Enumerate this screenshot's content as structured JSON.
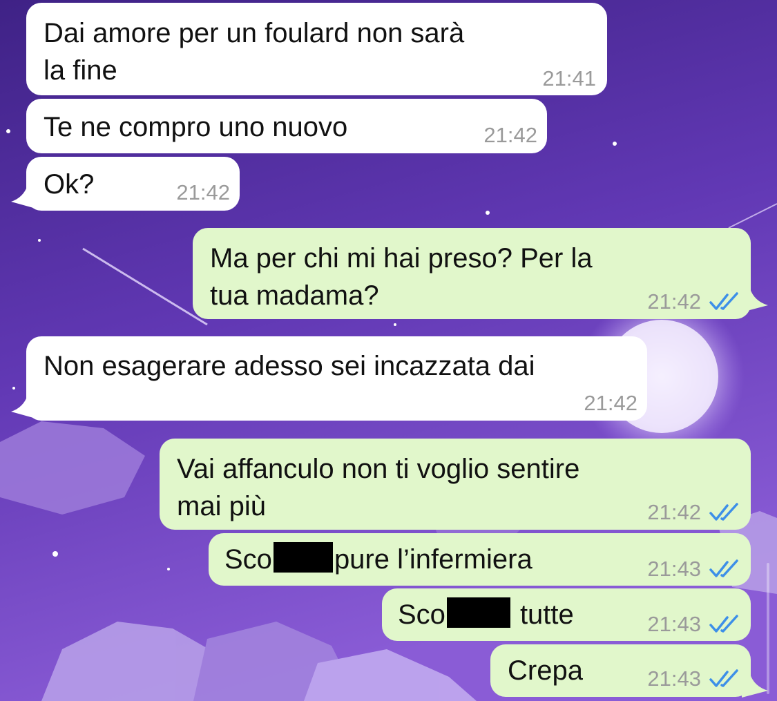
{
  "chat": {
    "messages": [
      {
        "direction": "incoming",
        "text_lines": [
          "Dai amore per un foulard non sarà",
          "la fine"
        ],
        "time": "21:41"
      },
      {
        "direction": "incoming",
        "text_lines": [
          "Te ne compro uno nuovo"
        ],
        "time": "21:42"
      },
      {
        "direction": "incoming",
        "text_lines": [
          "Ok?"
        ],
        "time": "21:42"
      },
      {
        "direction": "outgoing",
        "text_lines": [
          "Ma per chi mi hai preso? Per la",
          "tua madama?"
        ],
        "time": "21:42",
        "read": true
      },
      {
        "direction": "incoming",
        "text_lines": [
          "Non esagerare adesso sei incazzata dai"
        ],
        "time": "21:42"
      },
      {
        "direction": "outgoing",
        "text_lines": [
          "Vai affanculo non ti voglio sentire",
          "mai più"
        ],
        "time": "21:42",
        "read": true
      },
      {
        "direction": "outgoing",
        "prefix": "Sco",
        "suffix": "pure l’infermiera",
        "redacted": true,
        "time": "21:43",
        "read": true
      },
      {
        "direction": "outgoing",
        "prefix": "Sco",
        "suffix": "tutte",
        "redacted": true,
        "time": "21:43",
        "read": true
      },
      {
        "direction": "outgoing",
        "text_lines": [
          "Crepa"
        ],
        "time": "21:43",
        "read": true
      }
    ]
  },
  "colors": {
    "incoming_bubble": "#ffffff",
    "outgoing_bubble": "#e1f7cb",
    "timestamp": "#9a9a9a",
    "read_ticks": "#3d8fe8",
    "wallpaper_top": "#3f2286",
    "wallpaper_bottom": "#8a5cd6"
  },
  "icons": {
    "read_receipt": "double-check-icon"
  }
}
